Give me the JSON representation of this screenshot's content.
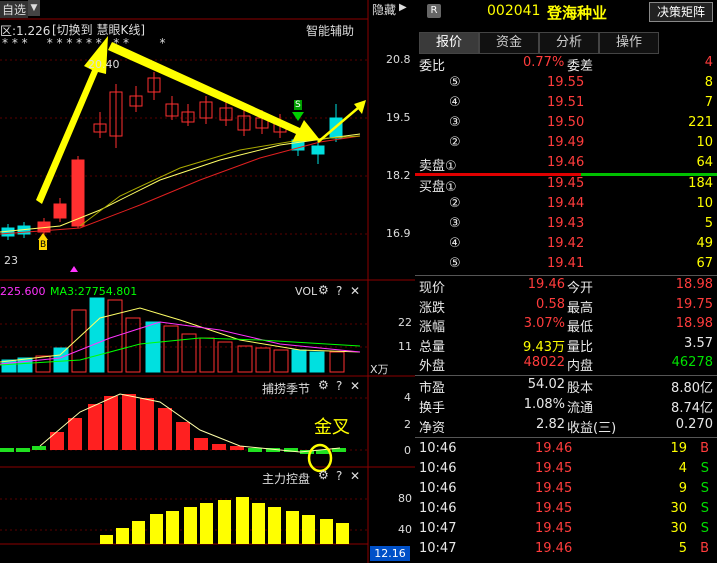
{
  "chart": {
    "top_left": {
      "label_a": "自选",
      "label_b": "区:1.226",
      "switch_text": "[切换到 慧眼K线]",
      "assist": "智能辅助",
      "star_row": "* * *     * * * * * *   * *        *"
    },
    "hide_btn": "隐藏",
    "price_axis": [
      "20.8",
      "19.5",
      "18.2",
      "16.9"
    ],
    "annot_high": "20.40",
    "annot_low": "23",
    "marker_b": "B",
    "marker_s": "S",
    "vol": {
      "ma_a": "225.600",
      "ma3_label": "MA3:27754.801",
      "title": "VOL",
      "axis": [
        "22",
        "11"
      ],
      "unit": "X万"
    },
    "season": {
      "title": "捕捞季节",
      "axis": [
        "4",
        "2",
        "0"
      ],
      "note": "金叉"
    },
    "main": {
      "title": "主力控盘",
      "axis": [
        "80",
        "40"
      ],
      "value": "12.16"
    },
    "icon_gear": "⚙",
    "icon_q": "?",
    "icon_x": "✕",
    "colors": {
      "up": "#ff3030",
      "down": "#00e0e0",
      "arrow": "#ffff00",
      "bg": "#000000"
    }
  },
  "quote": {
    "badge": "R",
    "code": "002041",
    "name": "登海种业",
    "matrix_btn": "决策矩阵",
    "tabs": [
      "报价",
      "资金",
      "分析",
      "操作"
    ],
    "weibi_label": "委比",
    "weibi": "0.77%",
    "weicha_label": "委差",
    "weicha": "4",
    "sell": [
      {
        "lbl": "⑤",
        "p": "19.55",
        "v": "8"
      },
      {
        "lbl": "④",
        "p": "19.51",
        "v": "7"
      },
      {
        "lbl": "③",
        "p": "19.50",
        "v": "221"
      },
      {
        "lbl": "②",
        "p": "19.49",
        "v": "10"
      },
      {
        "lbl": "卖盘①",
        "p": "19.46",
        "v": "64"
      }
    ],
    "buy": [
      {
        "lbl": "买盘①",
        "p": "19.45",
        "v": "184"
      },
      {
        "lbl": "②",
        "p": "19.44",
        "v": "10"
      },
      {
        "lbl": "③",
        "p": "19.43",
        "v": "5"
      },
      {
        "lbl": "④",
        "p": "19.42",
        "v": "49"
      },
      {
        "lbl": "⑤",
        "p": "19.41",
        "v": "67"
      }
    ],
    "stats": [
      {
        "l1": "现价",
        "v1": "19.46",
        "l2": "今开",
        "v2": "18.98"
      },
      {
        "l1": "涨跌",
        "v1": "0.58",
        "l2": "最高",
        "v2": "19.75"
      },
      {
        "l1": "涨幅",
        "v1": "3.07%",
        "l2": "最低",
        "v2": "18.98"
      },
      {
        "l1": "总量",
        "v1": "9.43万",
        "l2": "量比",
        "v2": "3.57"
      },
      {
        "l1": "外盘",
        "v1": "48022",
        "l2": "内盘",
        "v2": "46278"
      }
    ],
    "stats2": [
      {
        "l1": "市盈",
        "v1": "54.02",
        "l2": "股本",
        "v2": "8.80亿"
      },
      {
        "l1": "换手",
        "v1": "1.08%",
        "l2": "流通",
        "v2": "8.74亿"
      },
      {
        "l1": "净资",
        "v1": "2.82",
        "l2": "收益(三)",
        "v2": "0.270"
      }
    ],
    "ticks": [
      {
        "t": "10:46",
        "p": "19.46",
        "v": "19",
        "d": "B"
      },
      {
        "t": "10:46",
        "p": "19.45",
        "v": "4",
        "d": "S"
      },
      {
        "t": "10:46",
        "p": "19.45",
        "v": "9",
        "d": "S"
      },
      {
        "t": "10:46",
        "p": "19.45",
        "v": "30",
        "d": "S"
      },
      {
        "t": "10:47",
        "p": "19.45",
        "v": "30",
        "d": "S"
      },
      {
        "t": "10:47",
        "p": "19.46",
        "v": "5",
        "d": "B"
      }
    ]
  }
}
